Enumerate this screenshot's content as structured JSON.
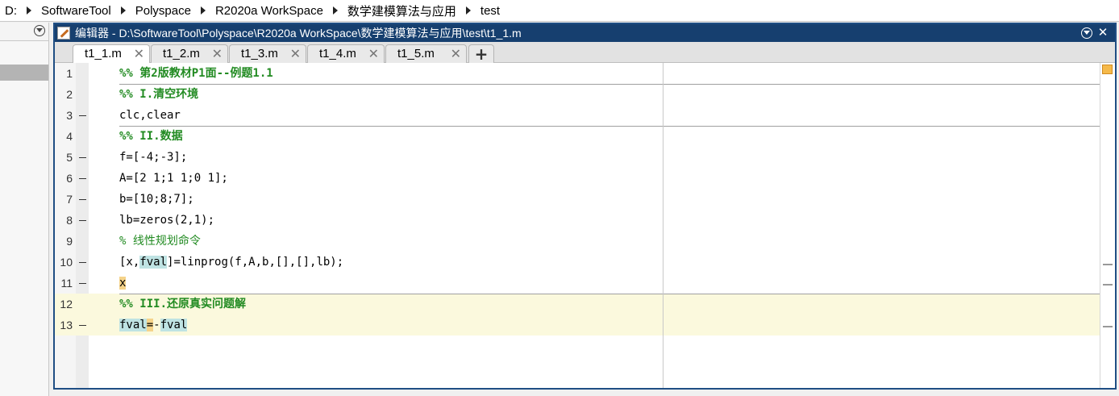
{
  "breadcrumb": [
    "D:",
    "SoftwareTool",
    "Polyspace",
    "R2020a WorkSpace",
    "数学建模算法与应用",
    "test"
  ],
  "editor": {
    "title": "编辑器 - D:\\SoftwareTool\\Polyspace\\R2020a WorkSpace\\数学建模算法与应用\\test\\t1_1.m",
    "tabs": [
      "t1_1.m",
      "t1_2.m",
      "t1_3.m",
      "t1_4.m",
      "t1_5.m"
    ],
    "tab_close": "✕",
    "add_tab": "+",
    "close_icon": "✕"
  },
  "code": {
    "line_numbers": [
      "1",
      "2",
      "3",
      "4",
      "5",
      "6",
      "7",
      "8",
      "9",
      "10",
      "11",
      "12",
      "13"
    ],
    "l1": "%% 第2版教材P1面--例题1.1",
    "l2": "%% I.清空环境",
    "l3": "clc,clear",
    "l4": "%% II.数据",
    "l5": "f=[-4;-3];",
    "l6": "A=[2 1;1 1;0 1];",
    "l7": "b=[10;8;7];",
    "l8": "lb=zeros(2,1);",
    "l9": "% 线性规划命令",
    "l10a": "[x,",
    "l10b": "fval",
    "l10c": "]=linprog(f,A,b,[],[],lb);",
    "l11": "x",
    "l12": "%% III.还原真实问题解",
    "l13a": "fval",
    "l13b": "=",
    "l13c": "-",
    "l13d": "fval"
  },
  "colors": {
    "title_bar": "#163f6f",
    "comment": "#228b22",
    "section_highlight": "#fbf9dd",
    "variable_highlight": "#bfe3e3"
  }
}
